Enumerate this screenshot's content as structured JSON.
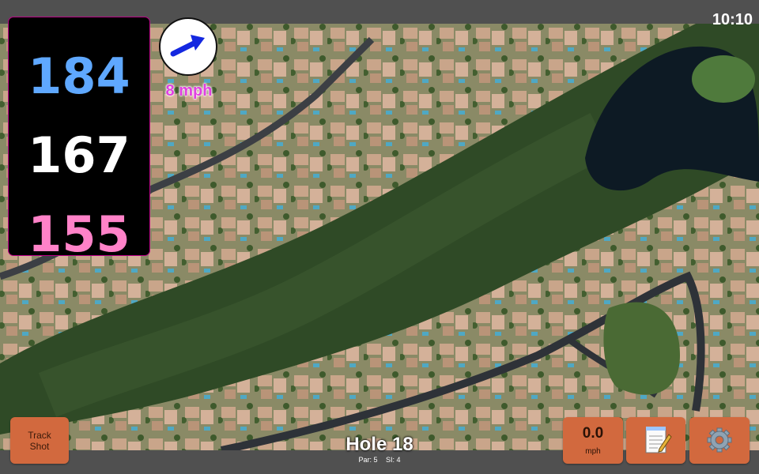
{
  "clock": "10:10",
  "distances": {
    "back": "184",
    "middle": "167",
    "front": "155"
  },
  "wind": {
    "speed": "8 mph",
    "direction_icon": "arrow-right-icon"
  },
  "buttons": {
    "track_shot_line1": "Track",
    "track_shot_line2": "Shot",
    "speed_value": "0.0",
    "speed_unit": "mph",
    "notes_icon": "notepad-icon",
    "settings_icon": "gear-icon"
  },
  "hole": {
    "title": "Hole 18",
    "par": "Par: 5",
    "si": "SI: 4"
  },
  "colors": {
    "back": "#5fa8ff",
    "middle": "#ffffff",
    "front": "#ff82c8",
    "button": "#d2693e",
    "wind_text": "#e040e0"
  }
}
